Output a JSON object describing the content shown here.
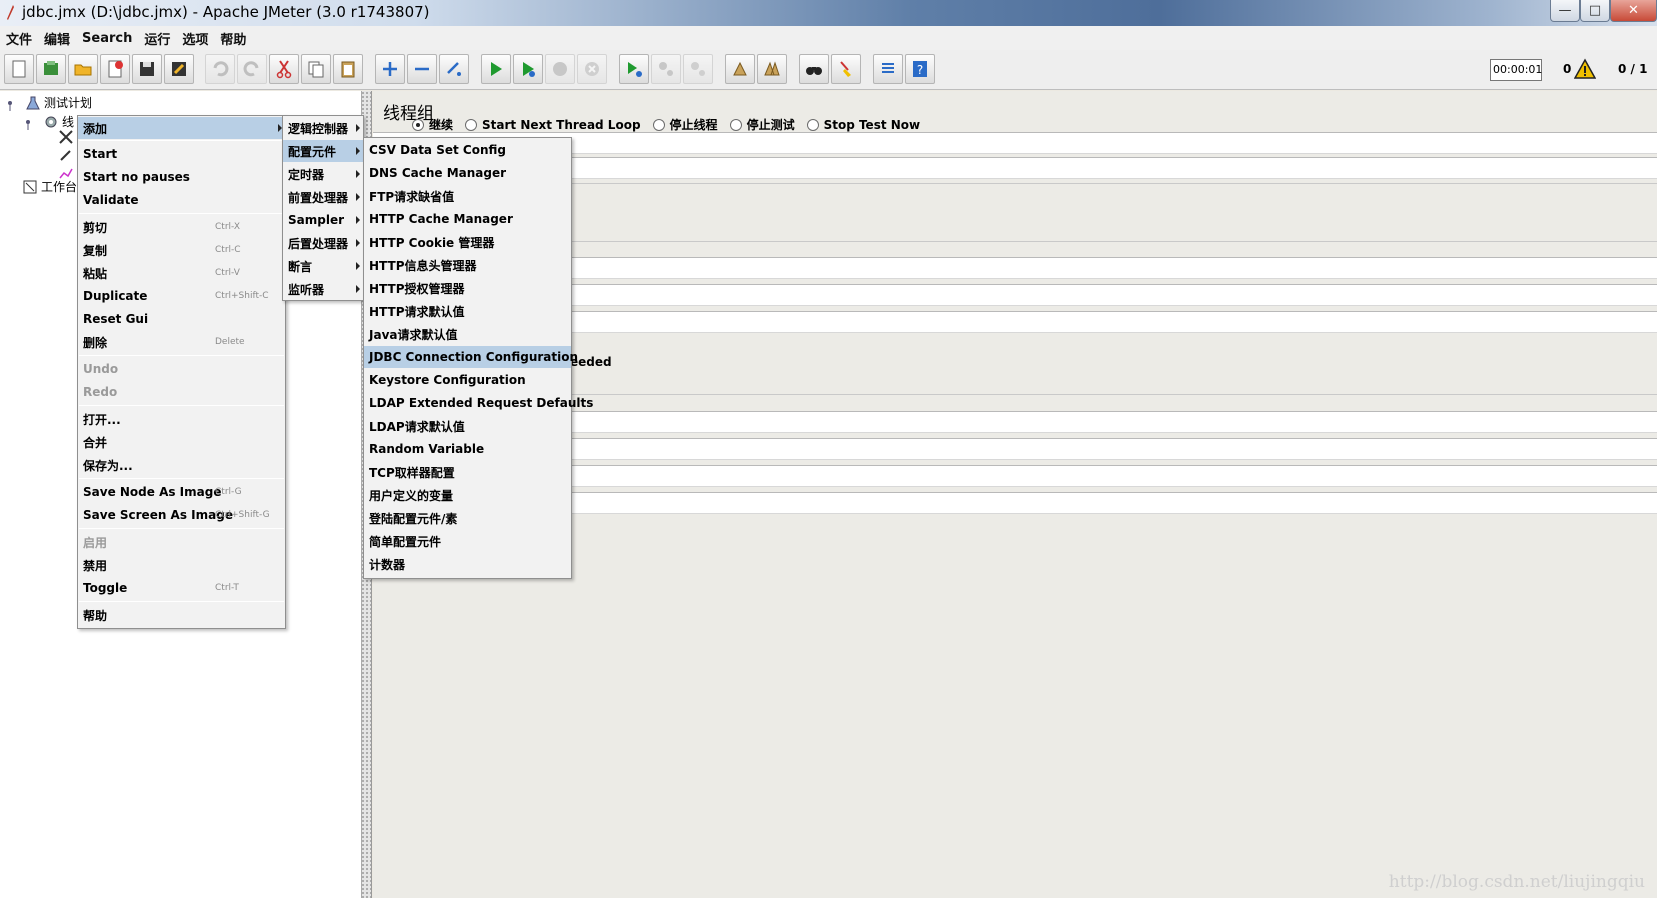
{
  "window": {
    "title": "jdbc.jmx (D:\\jdbc.jmx) - Apache JMeter (3.0 r1743807)"
  },
  "menubar": [
    "文件",
    "编辑",
    "Search",
    "运行",
    "选项",
    "帮助"
  ],
  "toolbar": {
    "timer": "00:00:01",
    "error_count": "0",
    "threads": "0 / 1"
  },
  "tree": {
    "root": "测试计划",
    "child": "线",
    "workbench": "工作台"
  },
  "thread_group": {
    "title": "线程组",
    "error_action_options": [
      "继续",
      "Start Next Thread Loop",
      "停止线程",
      "停止测试",
      "Stop Test Now"
    ],
    "selected_option": "继续",
    "partial_label": "eeded"
  },
  "context_menu": {
    "add": "添加",
    "start": "Start",
    "start_no_pauses": "Start no pauses",
    "validate": "Validate",
    "cut": "剪切",
    "cut_key": "Ctrl-X",
    "copy": "复制",
    "copy_key": "Ctrl-C",
    "paste": "粘贴",
    "paste_key": "Ctrl-V",
    "duplicate": "Duplicate",
    "duplicate_key": "Ctrl+Shift-C",
    "reset_gui": "Reset Gui",
    "delete": "删除",
    "delete_key": "Delete",
    "undo": "Undo",
    "redo": "Redo",
    "open": "打开...",
    "merge": "合并",
    "save_as": "保存为...",
    "save_node_image": "Save Node As Image",
    "save_node_image_key": "Ctrl-G",
    "save_screen_image": "Save Screen As Image",
    "save_screen_image_key": "Ctrl+Shift-G",
    "enable": "启用",
    "disable": "禁用",
    "toggle": "Toggle",
    "toggle_key": "Ctrl-T",
    "help": "帮助"
  },
  "add_submenu": [
    "逻辑控制器",
    "配置元件",
    "定时器",
    "前置处理器",
    "Sampler",
    "后置处理器",
    "断言",
    "监听器"
  ],
  "config_submenu": [
    "CSV Data Set Config",
    "DNS Cache Manager",
    "FTP请求缺省值",
    "HTTP Cache Manager",
    "HTTP Cookie 管理器",
    "HTTP信息头管理器",
    "HTTP授权管理器",
    "HTTP请求默认值",
    "Java请求默认值",
    "JDBC Connection Configuration",
    "Keystore Configuration",
    "LDAP Extended Request Defaults",
    "LDAP请求默认值",
    "Random Variable",
    "TCP取样器配置",
    "用户定义的变量",
    "登陆配置元件/素",
    "简单配置元件",
    "计数器"
  ],
  "watermark": "http://blog.csdn.net/liujingqiu"
}
